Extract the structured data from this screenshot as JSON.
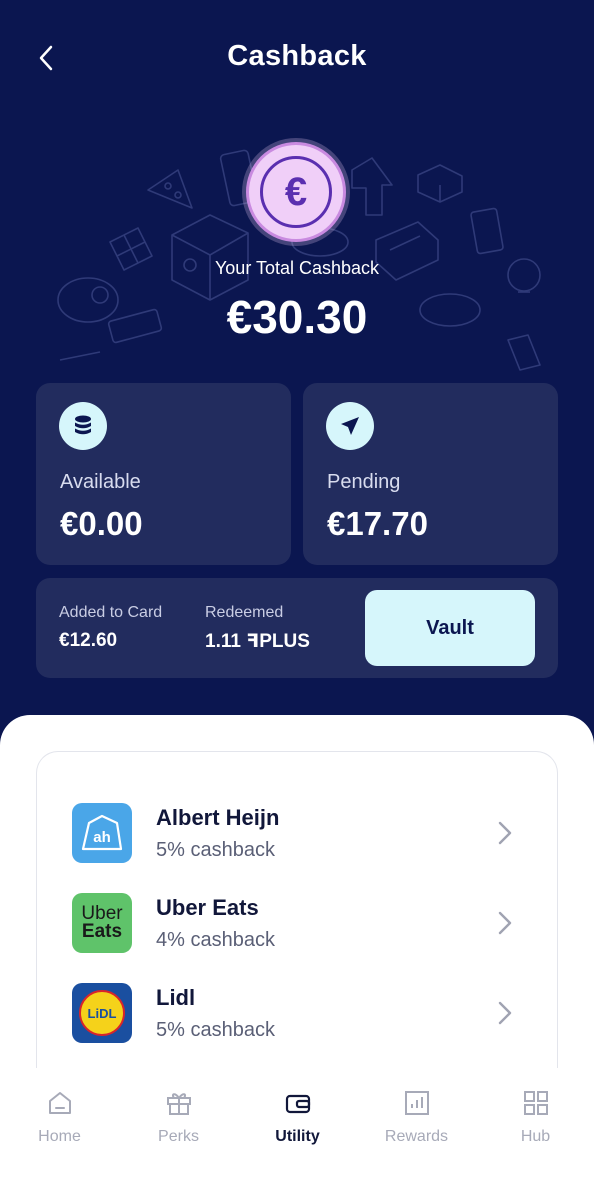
{
  "header": {
    "title": "Cashback",
    "back_icon": "chevron-left-icon"
  },
  "hero": {
    "coin_symbol": "€",
    "total_label": "Your Total Cashback",
    "total_value": "€30.30"
  },
  "cards": {
    "available": {
      "icon": "coins-stack-icon",
      "label": "Available",
      "value": "€0.00"
    },
    "pending": {
      "icon": "send-arrow-icon",
      "label": "Pending",
      "value": "€17.70"
    }
  },
  "summary": {
    "added_label": "Added to Card",
    "added_value": "€12.60",
    "redeemed_label": "Redeemed",
    "redeemed_value": "1.11 ꟻPLUS",
    "vault_button": "Vault"
  },
  "merchants": [
    {
      "name": "Albert Heijn",
      "cashback": "5% cashback",
      "logo_text": "ah",
      "logo_color": "#4aa6e8"
    },
    {
      "name": "Uber Eats",
      "cashback": "4% cashback",
      "logo_text_1": "Uber",
      "logo_text_2": "Eats",
      "logo_color": "#5fc36a"
    },
    {
      "name": "Lidl",
      "cashback": "5% cashback",
      "logo_text": "LiDL",
      "logo_color": "#1a4fa0"
    }
  ],
  "nav": [
    {
      "label": "Home",
      "icon": "home-icon",
      "active": false
    },
    {
      "label": "Perks",
      "icon": "gift-icon",
      "active": false
    },
    {
      "label": "Utility",
      "icon": "wallet-icon",
      "active": true
    },
    {
      "label": "Rewards",
      "icon": "chart-icon",
      "active": false
    },
    {
      "label": "Hub",
      "icon": "grid-icon",
      "active": false
    }
  ],
  "colors": {
    "background": "#0b1650",
    "card": "#222c5e",
    "accent_light": "#d6f6fb",
    "coin": "#f0cff8",
    "text_dark": "#11173a"
  }
}
